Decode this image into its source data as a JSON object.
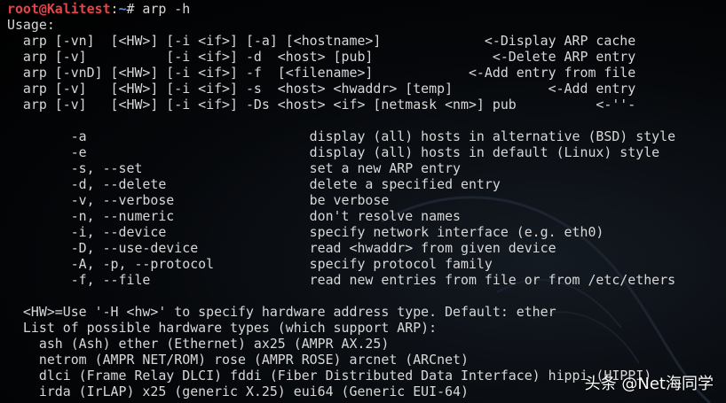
{
  "prompt": {
    "user_host": "root@Kalitest",
    "separator": ":",
    "path": "~",
    "symbol": "# ",
    "command": "arp -h"
  },
  "output_lines": [
    "Usage:",
    "  arp [-vn]  [<HW>] [-i <if>] [-a] [<hostname>]             <-Display ARP cache",
    "  arp [-v]          [-i <if>] -d  <host> [pub]               <-Delete ARP entry",
    "  arp [-vnD] [<HW>] [-i <if>] -f  [<filename>]            <-Add entry from file",
    "  arp [-v]   [<HW>] [-i <if>] -s  <host> <hwaddr> [temp]            <-Add entry",
    "  arp [-v]   [<HW>] [-i <if>] -Ds <host> <if> [netmask <nm>] pub          <-''-",
    "",
    "        -a                            display (all) hosts in alternative (BSD) style",
    "        -e                            display (all) hosts in default (Linux) style",
    "        -s, --set                     set a new ARP entry",
    "        -d, --delete                  delete a specified entry",
    "        -v, --verbose                 be verbose",
    "        -n, --numeric                 don't resolve names",
    "        -i, --device                  specify network interface (e.g. eth0)",
    "        -D, --use-device              read <hwaddr> from given device",
    "        -A, -p, --protocol            specify protocol family",
    "        -f, --file                    read new entries from file or from /etc/ethers",
    "",
    "  <HW>=Use '-H <hw>' to specify hardware address type. Default: ether",
    "  List of possible hardware types (which support ARP):",
    "    ash (Ash) ether (Ethernet) ax25 (AMPR AX.25)",
    "    netrom (AMPR NET/ROM) rose (AMPR ROSE) arcnet (ARCnet)",
    "    dlci (Frame Relay DLCI) fddi (Fiber Distributed Data Interface) hippi (HIPPI)",
    "    irda (IrLAP) x25 (generic X.25) eui64 (Generic EUI-64)"
  ],
  "watermark": "头条 @Net海同学"
}
